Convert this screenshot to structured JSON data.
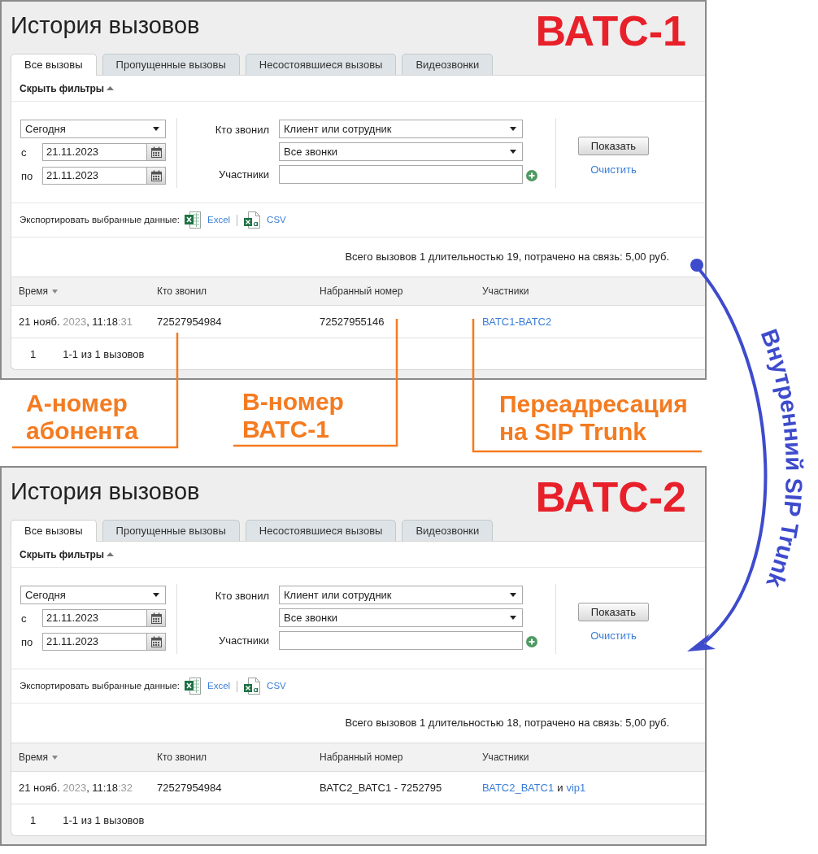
{
  "panels": [
    {
      "title": "История вызовов",
      "station_label": "ВАТС-1",
      "tabs": [
        {
          "label": "Все вызовы",
          "selected": true
        },
        {
          "label": "Пропущенные вызовы",
          "selected": false
        },
        {
          "label": "Несостоявшиеся вызовы",
          "selected": false
        },
        {
          "label": "Видеозвонки",
          "selected": false
        }
      ],
      "filters_toggle": {
        "label": "Скрыть фильтры",
        "expanded": true
      },
      "filters": {
        "period": "Сегодня",
        "from_label": "с",
        "from": "21.11.2023",
        "to_label": "по",
        "to": "21.11.2023",
        "caller_label": "Кто звонил",
        "caller": "Клиент или сотрудник",
        "call_type": "Все звонки",
        "participants_label": "Участники"
      },
      "show_button": "Показать",
      "clear_link": "Очистить",
      "export": {
        "label": "Экспортировать выбранные данные:",
        "formats": [
          {
            "kind": "excel",
            "label": "Excel"
          },
          {
            "kind": "csv",
            "label": "CSV"
          }
        ]
      },
      "summary": "Всего вызовов 1 длительностью 19, потрачено на связь: 5,00 руб.",
      "table": {
        "columns": [
          {
            "label": "Время",
            "sorted": true
          },
          {
            "label": "Кто звонил",
            "sorted": false
          },
          {
            "label": "Набранный номер",
            "sorted": false
          },
          {
            "label": "Участники",
            "sorted": false
          }
        ],
        "rows": [
          {
            "time": [
              {
                "text": "21 нояб. ",
                "muted": false
              },
              {
                "text": "2023",
                "muted": true
              },
              {
                "text": ", 11:18",
                "muted": false
              },
              {
                "text": ":31",
                "muted": true
              }
            ],
            "caller": "72527954984",
            "dialed": "72527955146",
            "participants": [
              {
                "kind": "link",
                "text": "ВАТС1-ВАТС2"
              }
            ]
          }
        ]
      },
      "pager": {
        "page": "1",
        "range": "1-1 из 1 вызовов"
      }
    },
    {
      "title": "История вызовов",
      "station_label": "ВАТС-2",
      "tabs": [
        {
          "label": "Все вызовы",
          "selected": true
        },
        {
          "label": "Пропущенные вызовы",
          "selected": false
        },
        {
          "label": "Несостоявшиеся вызовы",
          "selected": false
        },
        {
          "label": "Видеозвонки",
          "selected": false
        }
      ],
      "filters_toggle": {
        "label": "Скрыть фильтры",
        "expanded": true
      },
      "filters": {
        "period": "Сегодня",
        "from_label": "с",
        "from": "21.11.2023",
        "to_label": "по",
        "to": "21.11.2023",
        "caller_label": "Кто звонил",
        "caller": "Клиент или сотрудник",
        "call_type": "Все звонки",
        "participants_label": "Участники"
      },
      "show_button": "Показать",
      "clear_link": "Очистить",
      "export": {
        "label": "Экспортировать выбранные данные:",
        "formats": [
          {
            "kind": "excel",
            "label": "Excel"
          },
          {
            "kind": "csv",
            "label": "CSV"
          }
        ]
      },
      "summary": "Всего вызовов 1 длительностью 18, потрачено на связь: 5,00 руб.",
      "table": {
        "columns": [
          {
            "label": "Время",
            "sorted": true
          },
          {
            "label": "Кто звонил",
            "sorted": false
          },
          {
            "label": "Набранный номер",
            "sorted": false
          },
          {
            "label": "Участники",
            "sorted": false
          }
        ],
        "rows": [
          {
            "time": [
              {
                "text": "21 нояб. ",
                "muted": false
              },
              {
                "text": "2023",
                "muted": true
              },
              {
                "text": ", 11:18",
                "muted": false
              },
              {
                "text": ":32",
                "muted": true
              }
            ],
            "caller": "72527954984",
            "dialed": "ВАТС2_ВАТС1 - 7252795",
            "participants": [
              {
                "kind": "link",
                "text": "ВАТС2_ВАТС1"
              },
              {
                "kind": "text",
                "text": "и"
              },
              {
                "kind": "link",
                "text": "vip1"
              }
            ]
          }
        ]
      },
      "pager": {
        "page": "1",
        "range": "1-1 из 1 вызовов"
      }
    }
  ],
  "annotations": [
    {
      "lines": [
        "А-номер",
        "абонента"
      ]
    },
    {
      "lines": [
        "В-номер",
        "ВАТС-1"
      ]
    },
    {
      "lines": [
        "Переадресация",
        "на SIP Trunk"
      ]
    }
  ],
  "connector": {
    "label": "Внутренний SIP Trunk"
  }
}
